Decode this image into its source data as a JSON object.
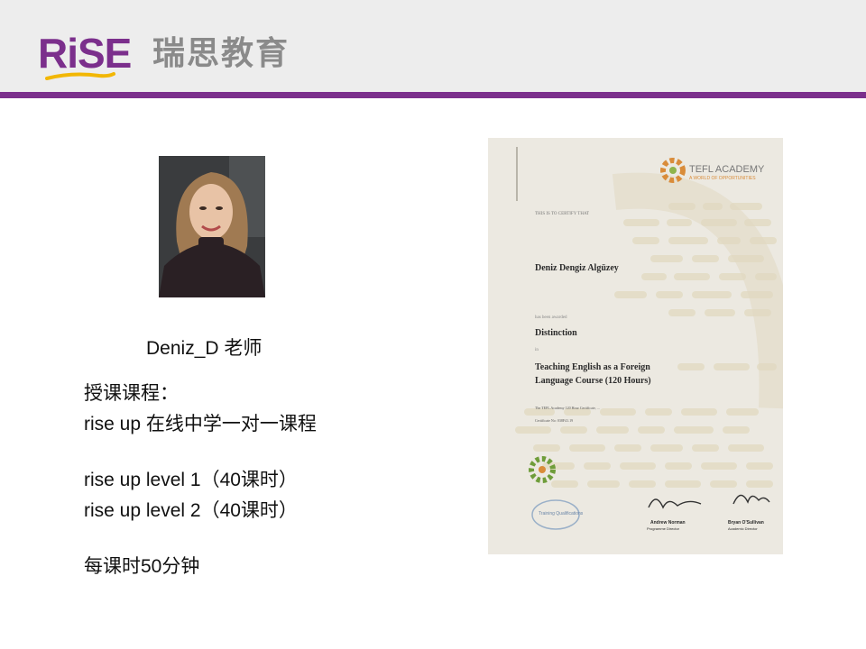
{
  "header": {
    "logo_word": "RiSE",
    "logo_chinese": "瑞思教育",
    "brand_color": "#7b2f8c"
  },
  "teacher": {
    "name": "Deniz_D 老师",
    "photo_icon": "teacher-portrait"
  },
  "courses": {
    "heading": "授课课程：",
    "line1": "rise up 在线中学一对一课程",
    "level1": "rise up level 1（40课时）",
    "level2": "rise up level 2（40课时）",
    "duration": "每课时50分钟"
  },
  "certificate": {
    "academy_name": "TEFL ACADEMY",
    "academy_tagline": "A WORLD OF OPPORTUNITIES",
    "certify_line": "THIS IS TO CERTIFY THAT",
    "recipient": "Deniz Dengiz Algüzey",
    "achieved_line": "has been awarded",
    "grade": "Distinction",
    "in_line": "in",
    "course_line1": "Teaching English as a Foreign",
    "course_line2": "Language Course (120 Hours)",
    "small_print": "The TEFL Academy 120 Hour Certificate, ...",
    "cert_no": "Certificate No: 038F41.19",
    "qualifications_label": "Training Qualifications",
    "signatory1_name": "Andrew Norman",
    "signatory1_title": "Programme Director",
    "signatory2_name": "Bryan O'Sullivan",
    "signatory2_title": "Academic Director"
  }
}
